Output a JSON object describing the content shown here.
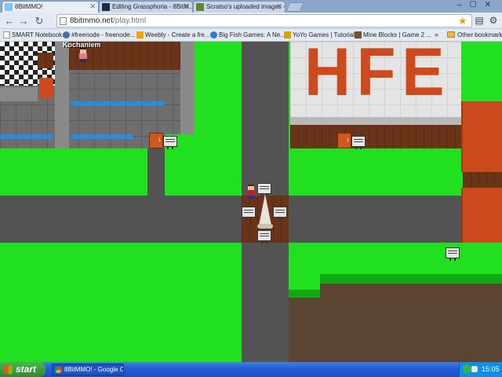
{
  "browser": {
    "tabs": [
      {
        "label": "8BitMMO!",
        "active": true,
        "icon": "8bitmmo-icon"
      },
      {
        "label": "Editing Grassphoria - 8BitM...",
        "active": false,
        "icon": "wiki-icon"
      },
      {
        "label": "Scratso's uploaded images -...",
        "active": false,
        "icon": "image-host-icon"
      }
    ],
    "url_domain": "8bitmmo.net",
    "url_path": "/play.html",
    "bookmarks": [
      {
        "label": "SMART Notebook...",
        "icon": "smart-icon"
      },
      {
        "label": "#freenode - freenode...",
        "icon": "freenode-icon"
      },
      {
        "label": "Weebly - Create a fre...",
        "icon": "weebly-icon"
      },
      {
        "label": "Big Fish Games: A Ne...",
        "icon": "bigfish-icon"
      },
      {
        "label": "YoYo Games | Tutorials",
        "icon": "yoyo-icon"
      },
      {
        "label": "Mine Blocks | Game 2 ...",
        "icon": "mineblocks-icon"
      }
    ],
    "bookmarks_more": "»",
    "other_bookmarks": "Other bookmarks"
  },
  "game": {
    "player_name": "Kochaniem",
    "building_sign_text": "HFE",
    "door_number": "1"
  },
  "taskbar": {
    "start_label": "start",
    "task_label": "8BitMMO! - Google C...",
    "clock": "15:05"
  },
  "colors": {
    "grass": "#20e020",
    "road": "#535353",
    "brick_orange": "#cc4a1e",
    "glass_blue": "#2f8ad8",
    "taskbar_blue": "#245ed8"
  }
}
